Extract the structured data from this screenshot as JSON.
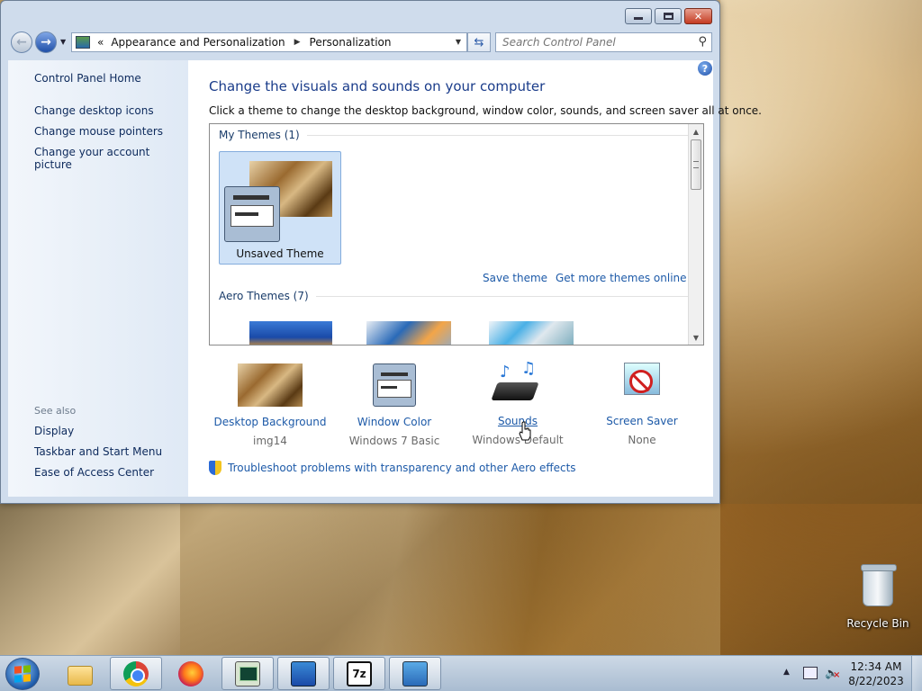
{
  "window": {
    "controls": {
      "minimize": "minimize",
      "maximize": "maximize",
      "close": "close"
    }
  },
  "nav": {
    "back_icon": "arrow-left-icon",
    "forward_icon": "arrow-right-icon",
    "address_overflow": "«",
    "breadcrumb": [
      "Appearance and Personalization",
      "Personalization"
    ],
    "search_placeholder": "Search Control Panel"
  },
  "sidebar": {
    "home": "Control Panel Home",
    "tasks": [
      "Change desktop icons",
      "Change mouse pointers",
      "Change your account picture"
    ],
    "see_also_label": "See also",
    "see_also": [
      "Display",
      "Taskbar and Start Menu",
      "Ease of Access Center"
    ]
  },
  "main": {
    "help_glyph": "?",
    "headline": "Change the visuals and sounds on your computer",
    "subtitle": "Click a theme to change the desktop background, window color, sounds, and screen saver all at once.",
    "my_themes_header": "My Themes (1)",
    "unsaved_theme": "Unsaved Theme",
    "save_theme": "Save theme",
    "get_more_themes": "Get more themes online",
    "aero_themes_header": "Aero Themes (7)",
    "settings": [
      {
        "label": "Desktop Background",
        "value": "img14",
        "icon": "desktop-background-icon"
      },
      {
        "label": "Window Color",
        "value": "Windows 7 Basic",
        "icon": "window-color-icon"
      },
      {
        "label": "Sounds",
        "value": "Windows Default",
        "icon": "sounds-icon"
      },
      {
        "label": "Screen Saver",
        "value": "None",
        "icon": "screen-saver-icon"
      }
    ],
    "troubleshoot": "Troubleshoot problems with transparency and other Aero effects"
  },
  "desktop": {
    "recycle_bin": "Recycle Bin"
  },
  "taskbar": {
    "apps": [
      "Windows Explorer",
      "Google Chrome",
      "Firefox",
      "Task Manager",
      "Remote Desktop",
      "7-Zip",
      "Control Panel"
    ],
    "seven_zip_glyph": "7z",
    "clock_time": "12:34 AM",
    "clock_date": "8/22/2023"
  },
  "colors": {
    "link": "#1d5aa8",
    "headline": "#1a3c8a",
    "close_button": "#c43b22"
  }
}
